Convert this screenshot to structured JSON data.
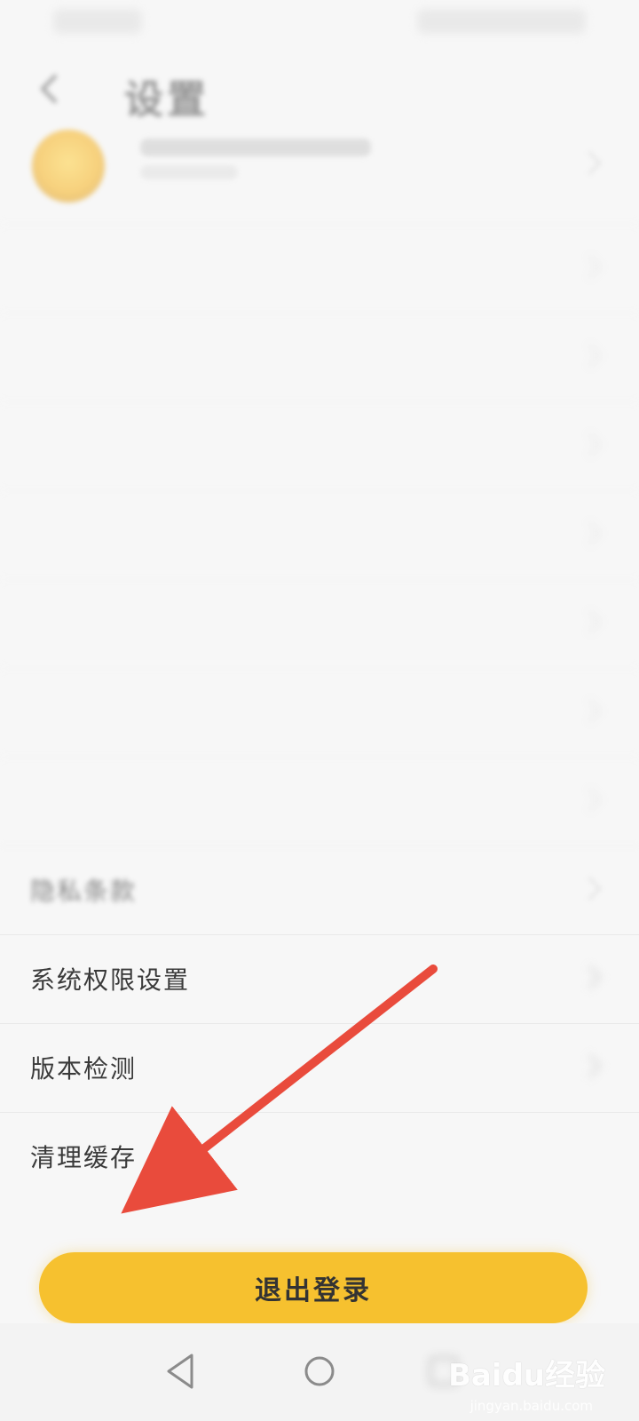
{
  "header": {
    "title": "设置"
  },
  "settings": {
    "items": [
      {
        "label": "",
        "value": ""
      },
      {
        "label": "",
        "value": ""
      },
      {
        "label": "",
        "value": ""
      },
      {
        "label": "",
        "value": ""
      },
      {
        "label": "",
        "value": ""
      },
      {
        "label": "",
        "value": ""
      },
      {
        "label": "",
        "value": ""
      },
      {
        "label": "隐私条款",
        "value": ""
      },
      {
        "label": "系统权限设置",
        "value": ""
      },
      {
        "label": "版本检测",
        "value": ""
      },
      {
        "label": "清理缓存",
        "value": ""
      }
    ]
  },
  "footer": {
    "logout_label": "退出登录"
  },
  "nav": {
    "back_icon": "triangle-back-icon",
    "home_icon": "circle-home-icon",
    "recent_icon": "square-recent-icon"
  },
  "watermark": {
    "text": "Baidu经验",
    "subtext": "jingyan.baidu.com"
  },
  "colors": {
    "accent": "#f6c12f",
    "arrow": "#e94b3c"
  }
}
